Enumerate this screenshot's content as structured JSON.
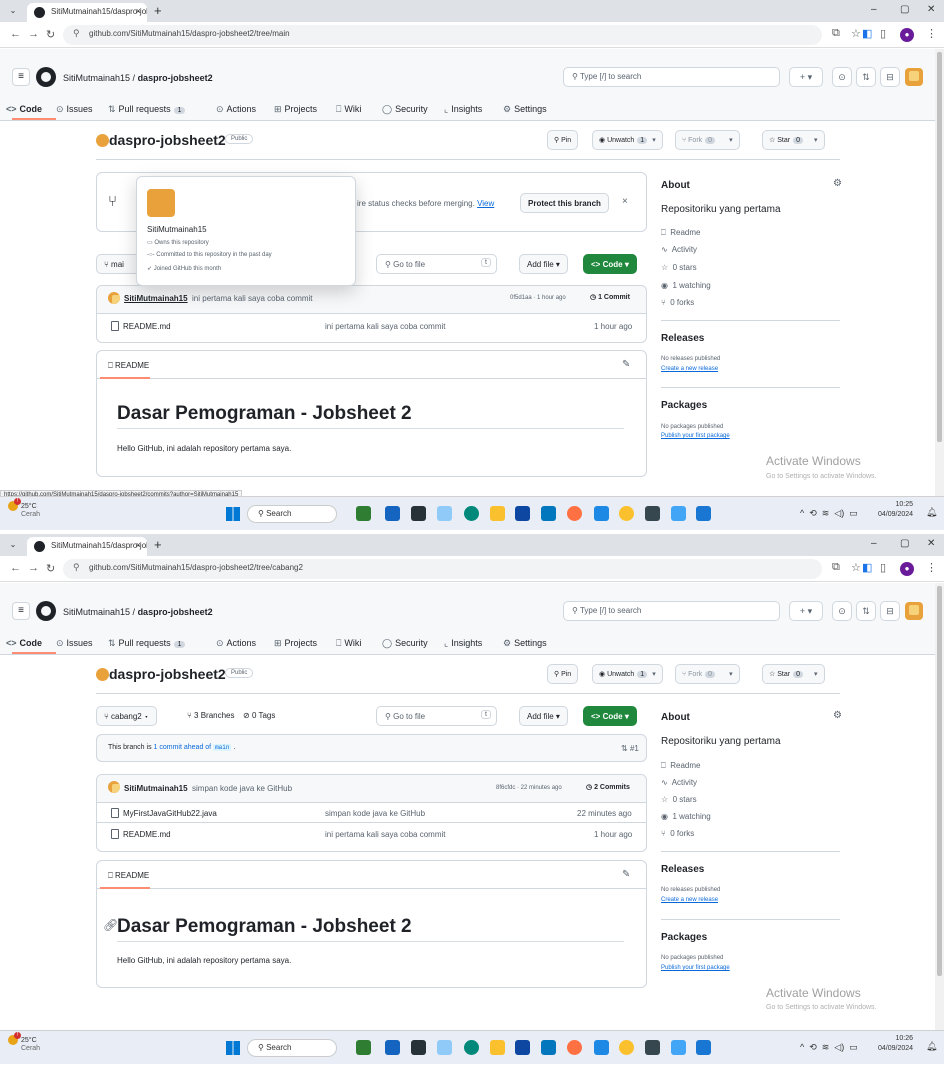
{
  "browser": {
    "tab_title": "SitiMutmainah15/daspro-jobsh",
    "tab_close": "×",
    "new_tab": "+",
    "tab_list_icon": "chevron-down-icon",
    "win_min": "–",
    "win_max": "▢",
    "win_close": "✕",
    "shot1_url": "github.com/SitiMutmainah15/daspro-jobsheet2/tree/main",
    "shot2_url": "github.com/SitiMutmainah15/daspro-jobsheet2/tree/cabang2"
  },
  "github": {
    "owner": "SitiMutmainah15",
    "separator": " / ",
    "repo": "daspro-jobsheet2",
    "search_placeholder": "Type [/] to search",
    "plus_label": "+ ▾",
    "public_badge": "Public",
    "nav": {
      "code": "Code",
      "issues": "Issues",
      "pull_requests": "Pull requests",
      "pull_requests_count": "1",
      "actions": "Actions",
      "projects": "Projects",
      "wiki": "Wiki",
      "security": "Security",
      "insights": "Insights",
      "settings": "Settings"
    },
    "actions": {
      "pin": "Pin",
      "unwatch": "Unwatch",
      "unwatch_count": "1",
      "fork": "Fork",
      "fork_count": "0",
      "star": "Star",
      "star_count": "0"
    },
    "about": {
      "title": "About",
      "description": "Repositoriku yang pertama",
      "readme": "Readme",
      "activity": "Activity",
      "stars": "0 stars",
      "watching": "1 watching",
      "forks": "0 forks"
    },
    "releases": {
      "title": "Releases",
      "none": "No releases published",
      "create": "Create a new release"
    },
    "packages": {
      "title": "Packages",
      "none": "No packages published",
      "publish": "Publish your first package"
    },
    "readme_label": "README",
    "readme_heading": "Dasar Pemograman - Jobsheet 2",
    "readme_text": "Hello GitHub, ini adalah repository pertama saya.",
    "go_to_file": "Go to file",
    "kbd_t": "t",
    "add_file": "Add file",
    "code_btn": "Code"
  },
  "shot1": {
    "branch_protect_text": "ire status checks before merging.",
    "branch_protect_link": "View",
    "protect_btn": "Protect this branch",
    "dismiss": "×",
    "branch_btn": "mai",
    "commit_author": "SitiMutmainah15",
    "commit_message": "ini pertama kali saya coba commit",
    "commit_meta": "0f5d1aa · 1 hour ago",
    "commit_count": "1 Commit",
    "files": [
      {
        "name": "README.md",
        "message": "ini pertama kali saya coba commit",
        "age": "1 hour ago"
      }
    ],
    "popup": {
      "name": "SitiMutmainah15",
      "line1": "Owns this repository",
      "line2": "Committed to this repository in the past day",
      "line3": "Joined GitHub this month"
    },
    "status_url": "https://github.com/SitiMutmainah15/daspro-jobsheet2/commits?author=SitiMutmainah15"
  },
  "shot2": {
    "branch_btn": "cabang2",
    "branches": "3 Branches",
    "tags": "0 Tags",
    "ahead_prefix": "This branch is ",
    "ahead_link": "1 commit ahead of",
    "ahead_base": "main",
    "ahead_suffix": " .",
    "pr_ref": "#1",
    "commit_author": "SitiMutmainah15",
    "commit_message": "simpan kode java ke GitHub",
    "commit_meta": "8f6cfdc · 22 minutes ago",
    "commit_count": "2 Commits",
    "files": [
      {
        "name": "MyFirstJavaGitHub22.java",
        "message": "simpan kode java ke GitHub",
        "age": "22 minutes ago"
      },
      {
        "name": "README.md",
        "message": "ini pertama kali saya coba commit",
        "age": "1 hour ago"
      }
    ]
  },
  "windows": {
    "activate_title": "Activate Windows",
    "activate_sub": "Go to Settings to activate Windows.",
    "temp": "25°C",
    "weather": "Cerah",
    "search": "Search",
    "shot1_time": "10:25",
    "shot2_time": "10:26",
    "date": "04/09/2024"
  },
  "colors": {
    "green": "#1f883d",
    "link": "#0969da",
    "accent_underline": "#fd8c73"
  }
}
